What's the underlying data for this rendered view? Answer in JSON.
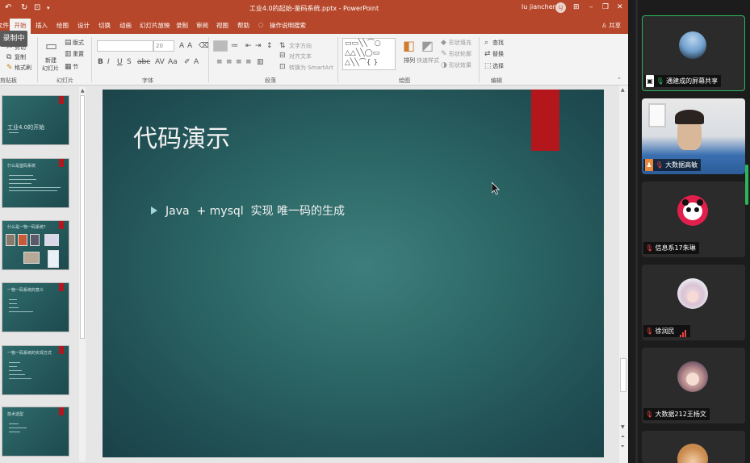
{
  "window": {
    "document_title": "工业4.0的起始-鉴码系统.pptx - PowerPoint",
    "user_name": "lu jiancheng",
    "user_initials": "LJ"
  },
  "quick_access": {
    "undo_icon": "undo-icon",
    "redo_icon": "redo-icon",
    "present_icon": "present-icon",
    "more_icon": "chevron-down-icon"
  },
  "ribbon_tabs": [
    "文件",
    "开始",
    "插入",
    "绘图",
    "设计",
    "切换",
    "动画",
    "幻灯片放映",
    "录制",
    "审阅",
    "视图",
    "帮助"
  ],
  "active_tab": "开始",
  "tell_me": "操作说明搜索",
  "share": "共享",
  "recording_badge": "录制中",
  "ribbon": {
    "clipboard": {
      "cut": "剪切",
      "copy": "复制",
      "format_painter": "格式刷",
      "group": "剪贴板"
    },
    "slides": {
      "new_slide_1": "新建",
      "new_slide_2": "幻灯片",
      "layout": "版式",
      "reset": "重置",
      "section": "节",
      "group": "幻灯片"
    },
    "font": {
      "size": "20",
      "bold": "B",
      "italic": "I",
      "underline": "U",
      "strike": "S",
      "group": "字体"
    },
    "paragraph": {
      "text_direction": "文字方向",
      "align_text": "对齐文本",
      "smartart": "转换为 SmartArt",
      "group": "段落"
    },
    "drawing": {
      "arrange": "排列",
      "quick_styles": "快速样式",
      "shape_fill": "形状填充",
      "shape_outline": "形状轮廓",
      "shape_effects": "形状效果",
      "group": "绘图"
    },
    "editing": {
      "find": "查找",
      "replace": "替换",
      "select": "选择",
      "group": "编辑"
    }
  },
  "thumbnails": [
    {
      "title": "工业4.0的开始"
    },
    {
      "title": "什么是鉴码系统"
    },
    {
      "title": "什么是一物一码系统？"
    },
    {
      "title": "一物一码系统的意义"
    },
    {
      "title": "一物一码系统的实现方式"
    },
    {
      "title": "技术选型"
    }
  ],
  "slide": {
    "title": "代码演示",
    "bullet": "Java  + mysql  实现 唯一码的生成",
    "accent_color": "#b3161b"
  },
  "participants": [
    {
      "name": "通建成的屏幕共享",
      "mic": "mic-on-icon",
      "kind": "screen-share"
    },
    {
      "name": "大数据高敏",
      "mic": "mic-muted-icon",
      "kind": "video"
    },
    {
      "name": "信息系17朱琳",
      "mic": "mic-muted-icon",
      "kind": "avatar-panda"
    },
    {
      "name": "徐润民",
      "mic": "mic-muted-icon",
      "kind": "avatar-anime"
    },
    {
      "name": "大数据212王杨文",
      "mic": "mic-muted-icon",
      "kind": "avatar-anime2"
    },
    {
      "name": "",
      "mic": "",
      "kind": "avatar-partial"
    }
  ]
}
